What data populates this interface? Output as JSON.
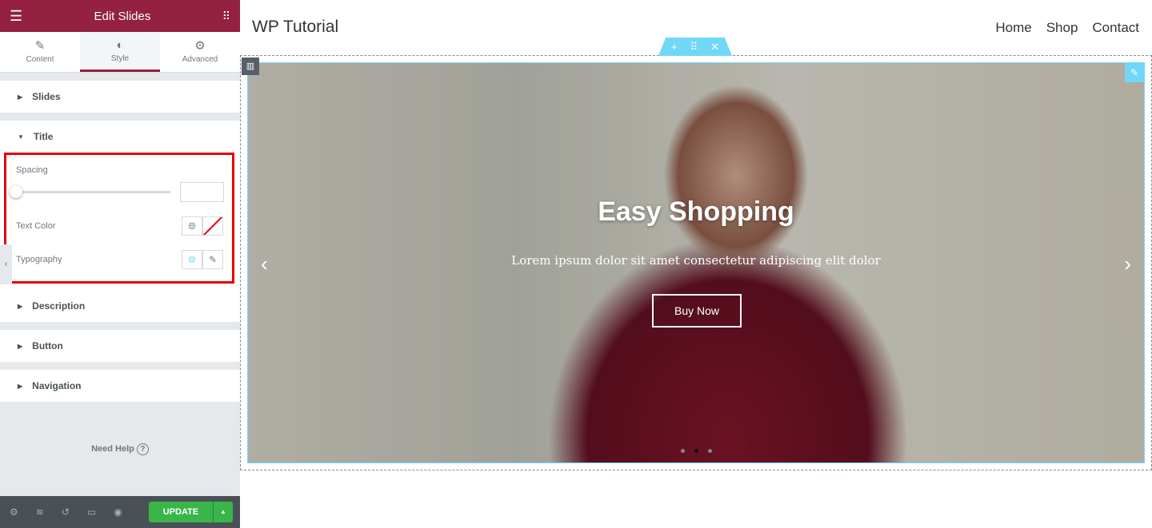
{
  "panel": {
    "title": "Edit Slides",
    "tabs": [
      {
        "label": "Content",
        "icon": "pencil-icon"
      },
      {
        "label": "Style",
        "icon": "contrast-icon"
      },
      {
        "label": "Advanced",
        "icon": "gear-icon"
      }
    ],
    "sections": [
      "Slides",
      "Title",
      "Description",
      "Button",
      "Navigation"
    ],
    "controls": {
      "spacing": "Spacing",
      "spacing_value": 0,
      "text_color": "Text Color",
      "typography": "Typography"
    },
    "help": "Need Help",
    "update": "UPDATE"
  },
  "site": {
    "logo": "WP Tutorial",
    "nav": [
      "Home",
      "Shop",
      "Contact"
    ]
  },
  "slide": {
    "title": "Easy Shopping",
    "description": "Lorem ipsum dolor sit amet consectetur adipiscing elit dolor",
    "button": "Buy Now",
    "dots": 3,
    "active_dot": 2
  },
  "colors": {
    "brand": "#93213f",
    "accent": "#71d7f7",
    "update": "#39b54a",
    "highlight": "#e60000"
  }
}
